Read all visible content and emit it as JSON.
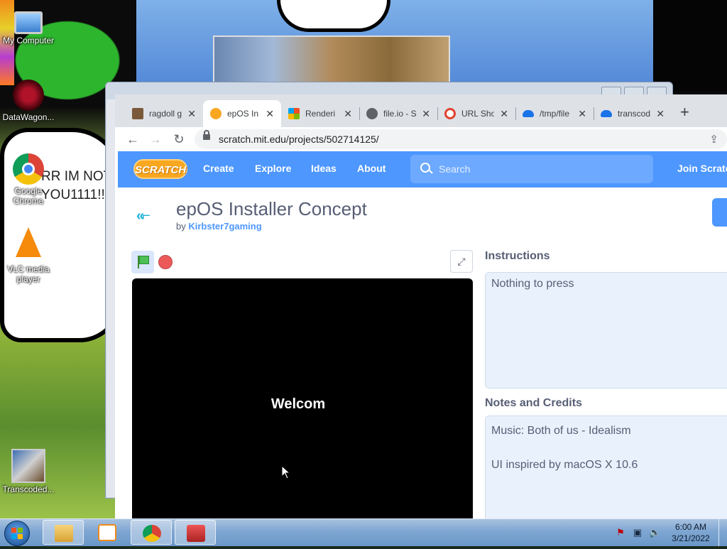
{
  "desktop": {
    "icons": [
      {
        "label": "My Computer",
        "icon": "computer-icon"
      },
      {
        "label": "DataWagon...",
        "icon": "datawagon-icon"
      },
      {
        "label": "Google Chrome",
        "icon": "chrome-icon"
      },
      {
        "label": "VLC media player",
        "icon": "vlc-icon"
      },
      {
        "label": "Transcoded...",
        "icon": "video-file-icon"
      }
    ],
    "wallpaper_text": [
      "RR IM NOT",
      "YOU1111!!"
    ]
  },
  "browser": {
    "tabs": [
      {
        "title": "ragdoll g",
        "icon": "ragdoll-favicon",
        "active": false
      },
      {
        "title": "epOS In",
        "icon": "scratch-favicon",
        "active": true
      },
      {
        "title": "Renderi",
        "icon": "windows-favicon",
        "active": false
      },
      {
        "title": "file.io - S",
        "icon": "globe-favicon",
        "active": false
      },
      {
        "title": "URL Sho",
        "icon": "url-favicon",
        "active": false
      },
      {
        "title": "/tmp/file",
        "icon": "cloud-upload-favicon",
        "active": false
      },
      {
        "title": "transcod",
        "icon": "cloud-upload-favicon",
        "active": false
      }
    ],
    "url": "scratch.mit.edu/projects/502714125/"
  },
  "scratch": {
    "logo": "SCRATCH",
    "nav": [
      "Create",
      "Explore",
      "Ideas",
      "About"
    ],
    "search_placeholder": "Search",
    "join": "Join Scratch",
    "project": {
      "title": "epOS Installer Concept",
      "by_label": "by",
      "author": "Kirbster7gaming"
    },
    "stage_text": "Welcom",
    "instructions": {
      "heading": "Instructions",
      "text": "Nothing to press"
    },
    "notes": {
      "heading": "Notes and Credits",
      "lines": [
        "Music: Both of us - Idealism",
        "UI inspired by macOS X 10.6"
      ]
    }
  },
  "taskbar": {
    "time": "6:00 AM",
    "date": "3/21/2022"
  }
}
